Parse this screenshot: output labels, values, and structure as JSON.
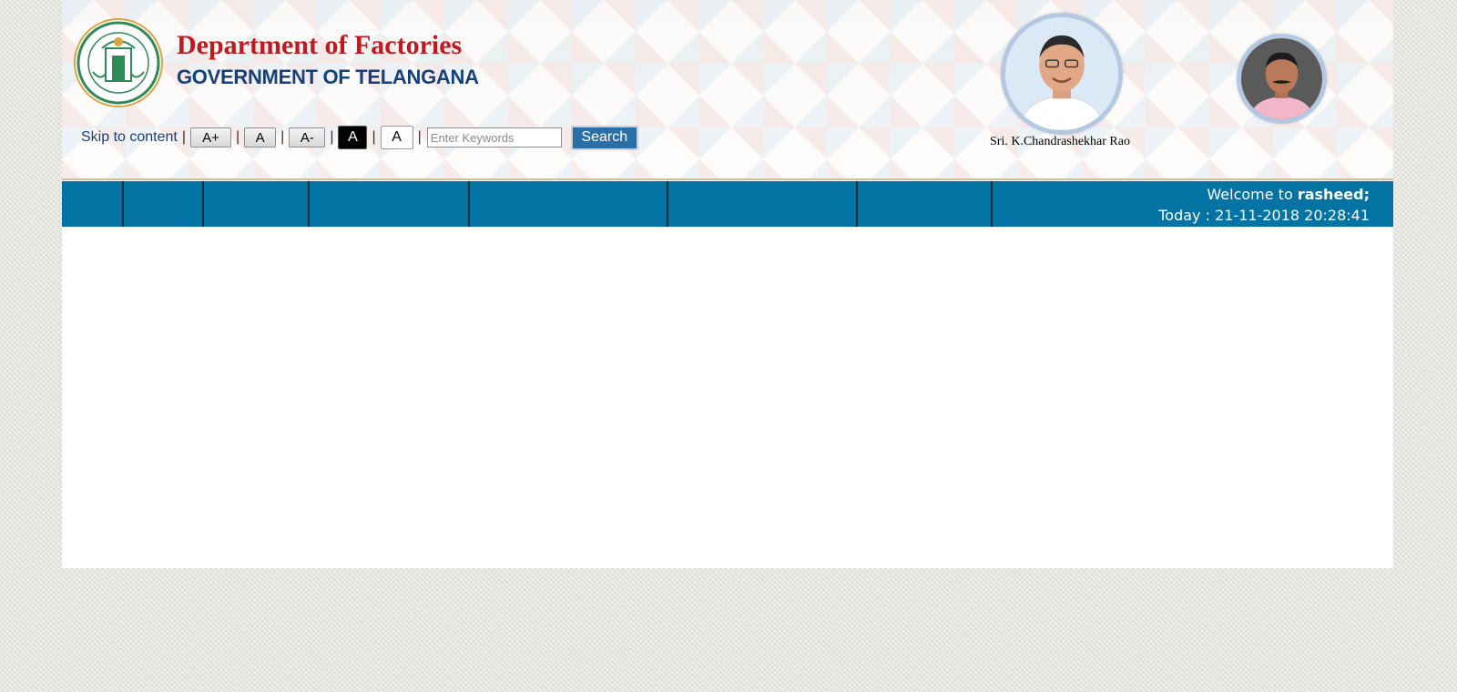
{
  "header": {
    "department_title": "Department of Factories",
    "government_title": "GOVERNMENT OF TELANGANA",
    "logo_icon": "telangana-state-emblem",
    "leader_caption": "Sri. K.Chandrashekhar Rao"
  },
  "toolbar": {
    "skip_link": "Skip to content",
    "separator": "|",
    "font_increase_label": "A+",
    "font_normal_label": "A",
    "font_decrease_label": "A-",
    "contrast_dark_label": "A",
    "contrast_light_label": "A",
    "search_placeholder": "Enter Keywords",
    "search_button_label": "Search"
  },
  "navbar": {
    "welcome_prefix": "Welcome to",
    "username": "rasheed;",
    "today_prefix": "Today :",
    "datetime": "21-11-2018 20:28:41"
  },
  "colors": {
    "navbar_bg": "#0273a3",
    "title_red": "#c0191f",
    "title_blue": "#17407a",
    "search_button": "#2b6fa8"
  }
}
